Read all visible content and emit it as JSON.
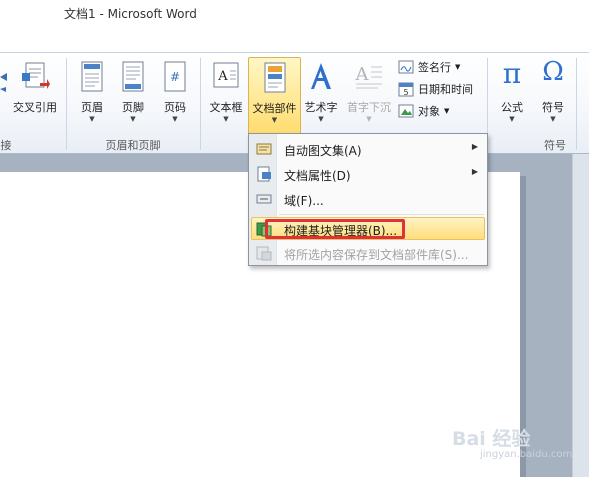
{
  "window": {
    "title": "文档1  -  Microsoft Word"
  },
  "ribbon": {
    "buttons": {
      "cross_ref": "交叉引用",
      "header": "页眉",
      "footer": "页脚",
      "page_number": "页码",
      "text_box": "文本框",
      "quick_parts": "文档部件",
      "wordart": "艺术字",
      "drop_cap": "首字下沉",
      "equation": "公式",
      "symbol": "符号"
    },
    "small_buttons": {
      "signature_line": "签名行",
      "date_time": "日期和时间",
      "object": "对象"
    },
    "groups": {
      "links_partial": "接",
      "header_footer": "页眉和页脚",
      "symbols": "符号"
    }
  },
  "menu": {
    "items": [
      {
        "label": "自动图文集(A)",
        "icon": "autotext-icon"
      },
      {
        "label": "文档属性(D)",
        "icon": "document-property-icon"
      },
      {
        "label": "域(F)...",
        "icon": "field-icon"
      },
      {
        "label": "构建基块管理器(B)...",
        "icon": "building-blocks-icon"
      },
      {
        "label": "将所选内容保存到文档部件库(S)...",
        "icon": "save-selection-icon"
      }
    ]
  },
  "watermark": {
    "logo": "Bai 经验",
    "url": "jingyan.baidu.com"
  },
  "colors": {
    "highlight": "#ffde7b",
    "annotation": "#e0303a",
    "ribbon_border": "#aab9cf"
  }
}
